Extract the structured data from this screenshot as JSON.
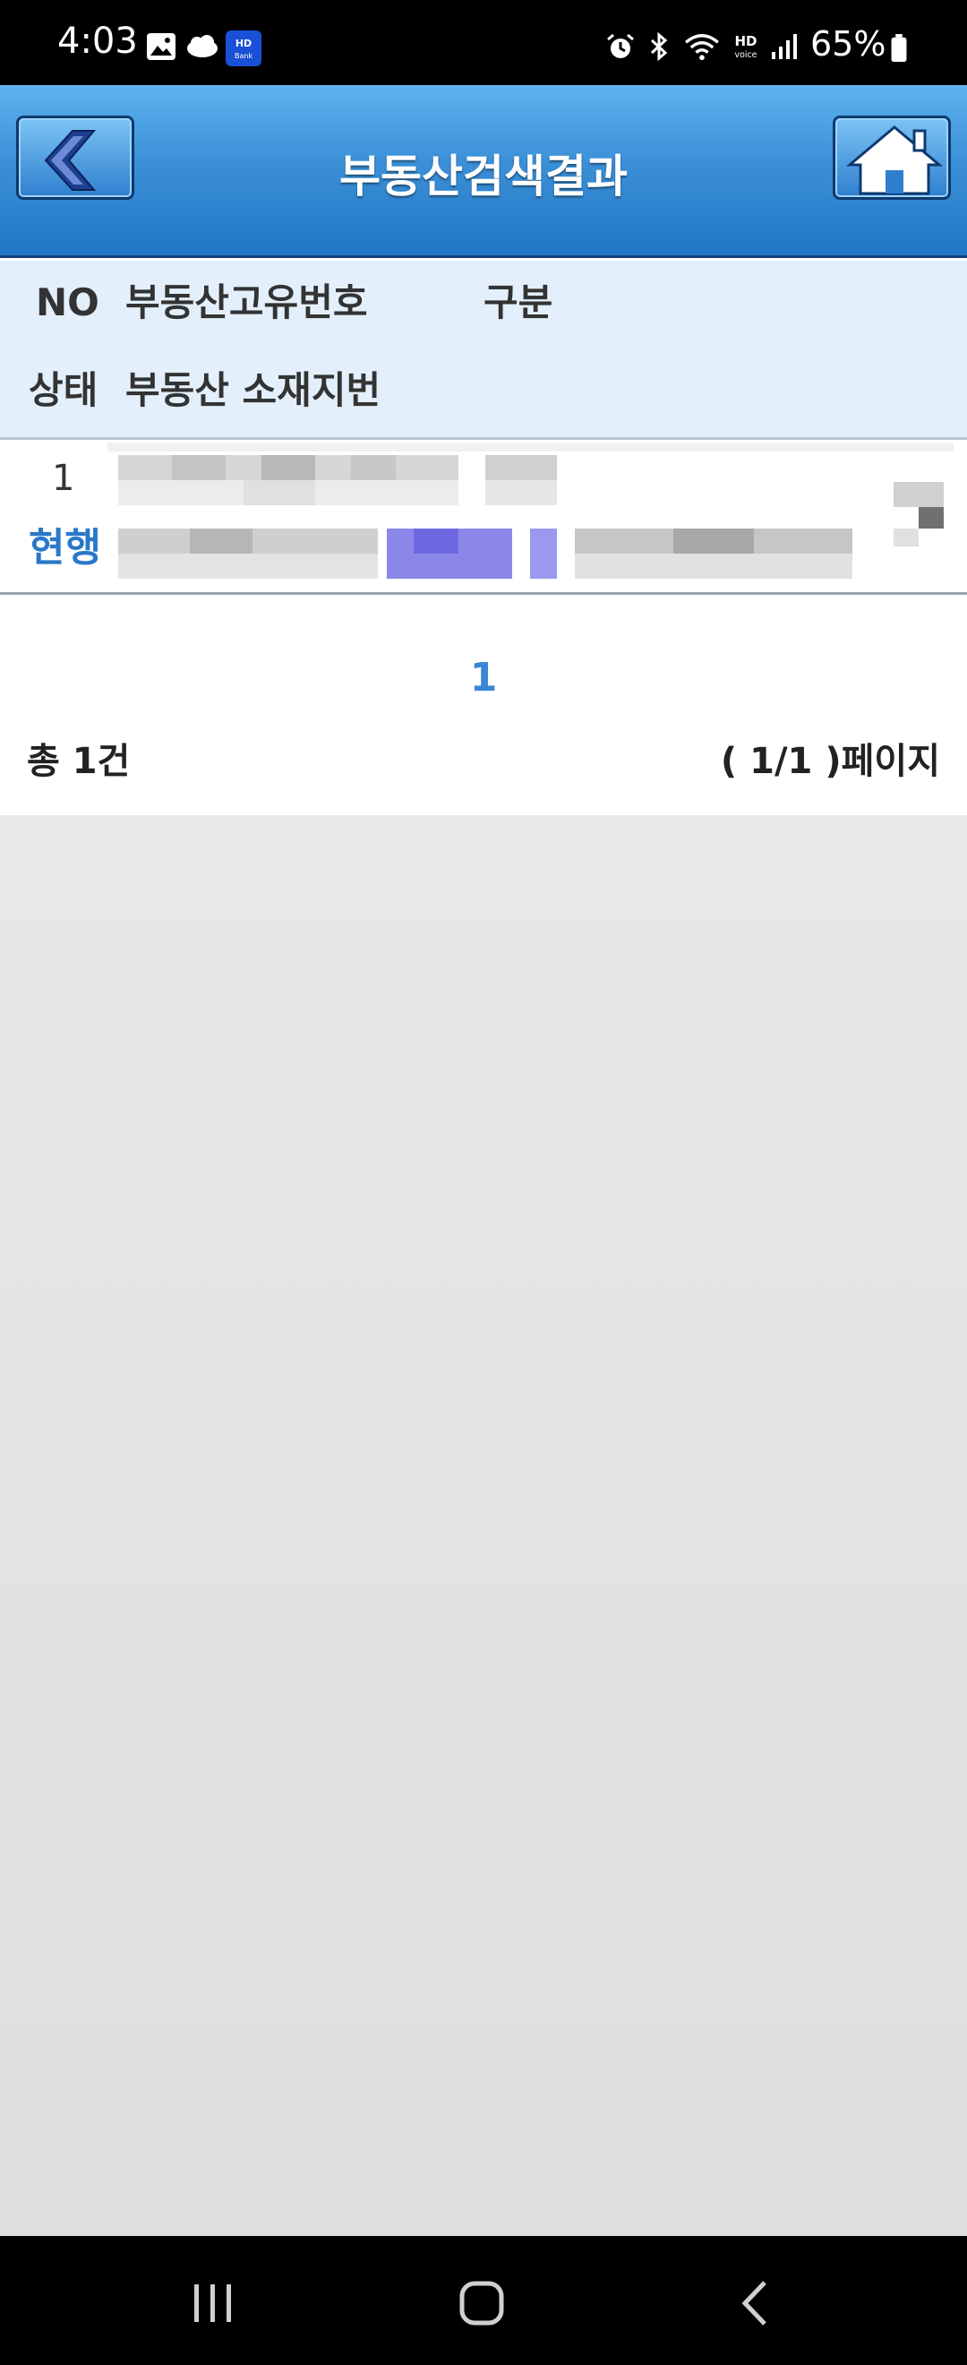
{
  "status_bar": {
    "time": "4:03",
    "battery": "65%",
    "left_icons": [
      "gallery-icon",
      "cloud-icon",
      "nh-bank-icon"
    ],
    "nh_bank_label": "NH Bank",
    "hd_label": "HD",
    "right_icons": [
      "alarm-icon",
      "bluetooth-icon",
      "wifi-icon",
      "hd-voice-icon",
      "signal-icon",
      "battery-icon"
    ]
  },
  "header": {
    "title": "부동산검색결과",
    "back_icon": "chevron-left-icon",
    "home_icon": "home-icon"
  },
  "table": {
    "columns_row1": [
      "NO",
      "부동산고유번호",
      "구분"
    ],
    "columns_row2": [
      "상태",
      "부동산 소재지번"
    ],
    "rows": [
      {
        "no": "1",
        "status": "현행"
      }
    ]
  },
  "pagination": {
    "current_page": "1",
    "total": "총 1건",
    "page_info": "( 1/1 )페이지"
  },
  "colors": {
    "header_blue": "#2277c4",
    "accent_blue": "#3a86d6",
    "column_header_bg": "#e3f0fb"
  },
  "nav_bar": {
    "icons": [
      "recents-icon",
      "home-nav-icon",
      "back-nav-icon"
    ]
  }
}
